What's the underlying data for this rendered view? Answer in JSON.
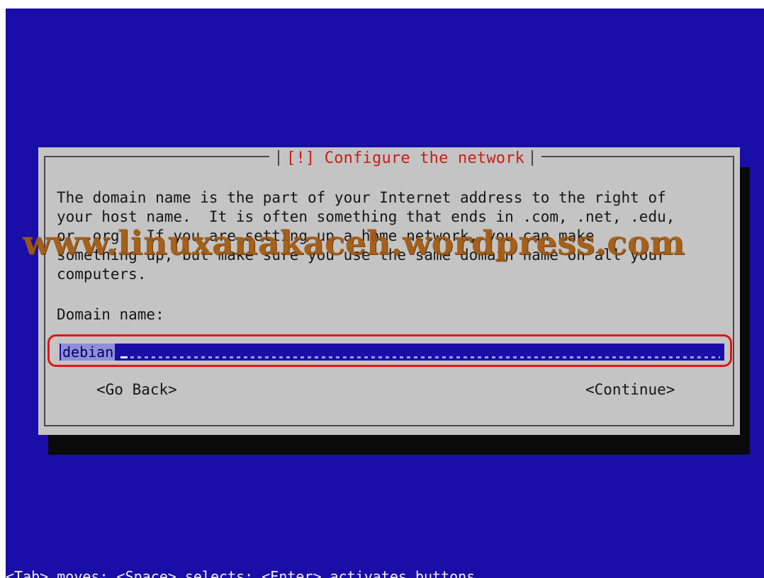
{
  "dialog": {
    "title": "[!] Configure the network",
    "body": "The domain name is the part of your Internet address to the right of\nyour host name.  It is often something that ends in .com, .net, .edu,\nor .org.  If you are setting up a home network, you can make\nsomething up, but make sure you use the same domain name on all your\ncomputers.",
    "field_label": "Domain name:",
    "field_value": "debian",
    "go_back_label": "<Go Back>",
    "continue_label": "<Continue>"
  },
  "watermark": "www.linuxanakaceh.wordpress.com",
  "status_bar": "<Tab> moves; <Space> selects; <Enter> activates buttons",
  "colors": {
    "screen_background": "#1a0ea8",
    "dialog_background": "#c4c4c4",
    "title_text": "#c61f18",
    "highlight_ring": "#e41414",
    "watermark": "#a35a10"
  }
}
